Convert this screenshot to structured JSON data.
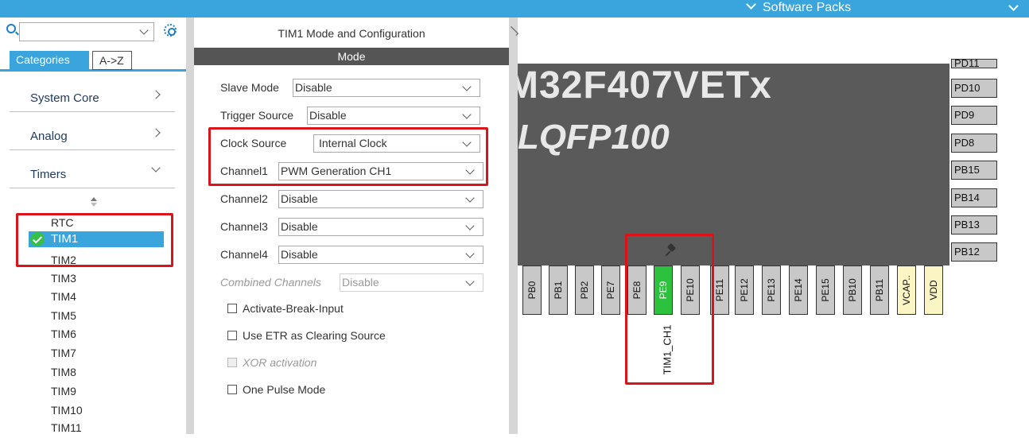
{
  "topbar": {
    "software_packs": "Software Packs"
  },
  "left": {
    "search": {
      "value": "",
      "placeholder": ""
    },
    "tabs": {
      "categories": "Categories",
      "az": "A->Z"
    },
    "categories": [
      {
        "label": "System Core"
      },
      {
        "label": "Analog"
      },
      {
        "label": "Timers"
      }
    ],
    "timers": [
      "RTC",
      "TIM1",
      "TIM2",
      "TIM3",
      "TIM4",
      "TIM5",
      "TIM6",
      "TIM7",
      "TIM8",
      "TIM9",
      "TIM10",
      "TIM11"
    ],
    "selected_timer": "TIM1"
  },
  "mid": {
    "title": "TIM1 Mode and Configuration",
    "mode": "Mode",
    "fields": {
      "slave_mode": {
        "label": "Slave Mode",
        "value": "Disable"
      },
      "trigger_source": {
        "label": "Trigger Source",
        "value": "Disable"
      },
      "clock_source": {
        "label": "Clock Source",
        "value": "Internal Clock"
      },
      "channel1": {
        "label": "Channel1",
        "value": "PWM Generation CH1"
      },
      "channel2": {
        "label": "Channel2",
        "value": "Disable"
      },
      "channel3": {
        "label": "Channel3",
        "value": "Disable"
      },
      "channel4": {
        "label": "Channel4",
        "value": "Disable"
      },
      "combined": {
        "label": "Combined Channels",
        "value": "Disable"
      }
    },
    "checkboxes": {
      "break": "Activate-Break-Input",
      "etr": "Use ETR as Clearing Source",
      "xor": "XOR activation",
      "one_pulse": "One Pulse Mode"
    }
  },
  "chip": {
    "name": "M32F407VETx",
    "package": "LQFP100",
    "right_pins": [
      "PD11",
      "PD10",
      "PD9",
      "PD8",
      "PB15",
      "PB14",
      "PB13",
      "PB12"
    ],
    "bottom_pins": [
      "PB0",
      "PB1",
      "PB2",
      "PE7",
      "PE8",
      "PE9",
      "PE10",
      "PE11",
      "PE12",
      "PE13",
      "PE14",
      "PE15",
      "PB10",
      "PB11",
      "VCAP..",
      "VDD"
    ],
    "signal_label": "TIM1_CH1",
    "colors": {
      "active_pin": "#2cc23e",
      "power_pin": "#fbf5c4",
      "highlight": "#d9141a"
    }
  }
}
